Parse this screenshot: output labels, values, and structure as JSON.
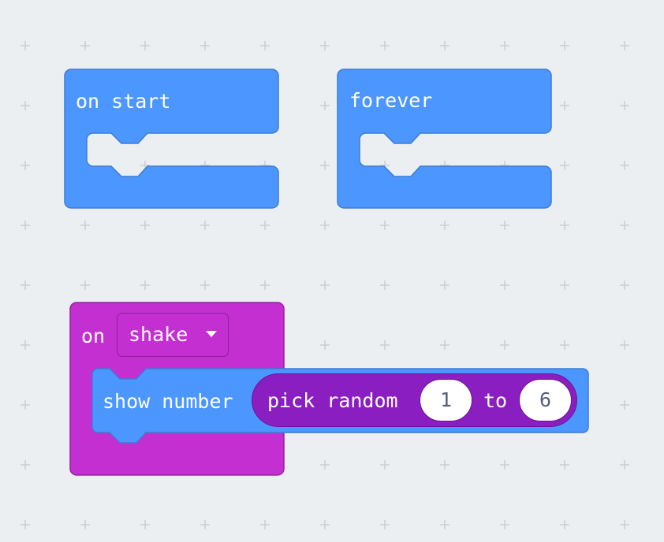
{
  "workspace": {
    "grid_color": "#c9ced4",
    "background": "#eceff1"
  },
  "blocks": {
    "on_start": {
      "label": "on start",
      "color": "#4c97ff"
    },
    "forever": {
      "label": "forever",
      "color": "#4c97ff"
    },
    "on_shake": {
      "on_label": "on",
      "dropdown_value": "shake",
      "color": "#c42fd2",
      "show_number": {
        "label": "show number",
        "color": "#4c97ff",
        "pick_random": {
          "label": "pick random",
          "to_label": "to",
          "from_value": "1",
          "to_value": "6",
          "color": "#8b1ec0"
        }
      }
    }
  }
}
